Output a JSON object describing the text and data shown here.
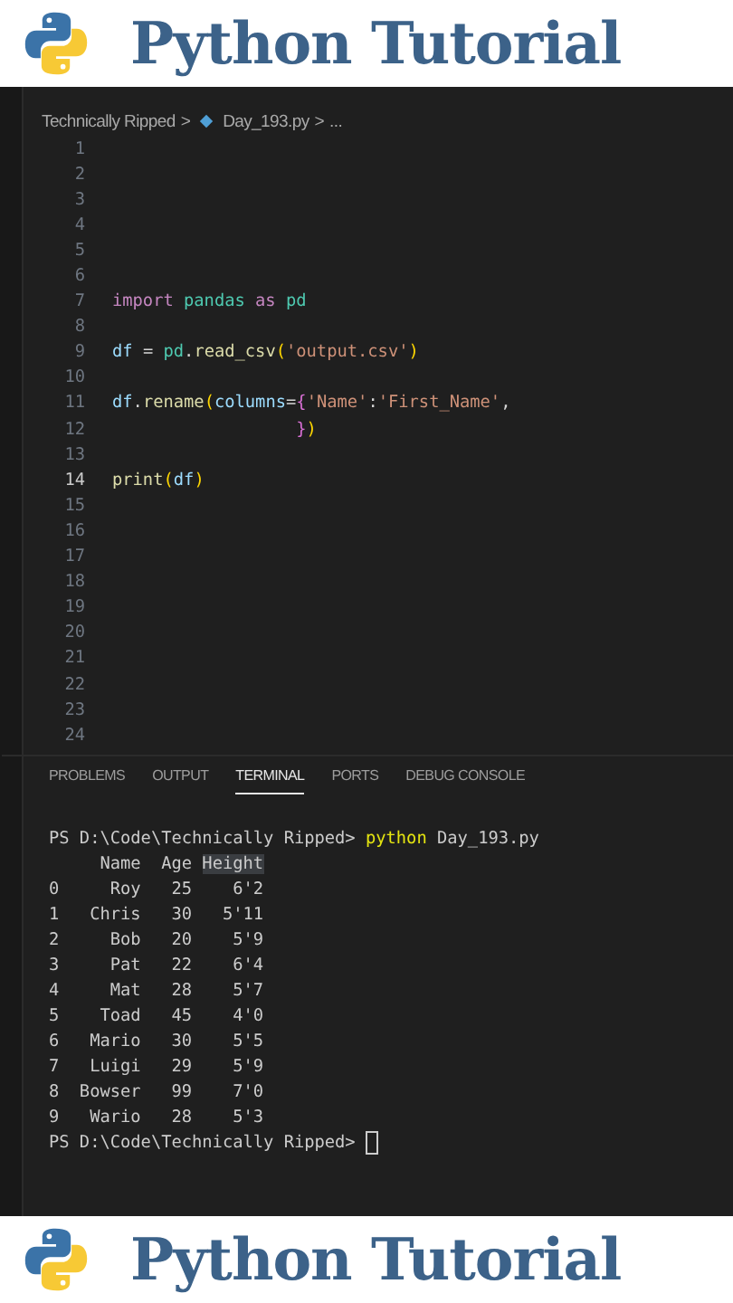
{
  "header": {
    "title": "Python Tutorial"
  },
  "breadcrumb": {
    "folder": "Technically Ripped",
    "separator": ">",
    "file": "Day_193.py",
    "tail": "..."
  },
  "code_lines": [
    {
      "number": "1",
      "current": false
    },
    {
      "number": "2",
      "current": false
    },
    {
      "number": "3",
      "current": false
    },
    {
      "number": "4",
      "current": false
    },
    {
      "number": "5",
      "current": false
    },
    {
      "number": "6",
      "current": false
    },
    {
      "number": "7",
      "current": false,
      "tokens": [
        {
          "text": "import",
          "kind": "keyword"
        },
        {
          "text": " pandas",
          "kind": "module"
        },
        {
          "text": " as",
          "kind": "keyword"
        },
        {
          "text": " pd",
          "kind": "module"
        }
      ]
    },
    {
      "number": "8",
      "current": false
    },
    {
      "number": "9",
      "current": false,
      "tokens": [
        {
          "text": "df",
          "kind": "variable"
        },
        {
          "text": " = ",
          "kind": "plain"
        },
        {
          "text": "pd",
          "kind": "module"
        },
        {
          "text": ".",
          "kind": "plain"
        },
        {
          "text": "read_csv",
          "kind": "function"
        },
        {
          "text": "(",
          "kind": "bracket"
        },
        {
          "text": "'output.csv'",
          "kind": "string"
        },
        {
          "text": ")",
          "kind": "bracket"
        }
      ]
    },
    {
      "number": "10",
      "current": false
    },
    {
      "number": "11",
      "current": false,
      "tokens": [
        {
          "text": "df",
          "kind": "variable"
        },
        {
          "text": ".",
          "kind": "plain"
        },
        {
          "text": "rename",
          "kind": "function"
        },
        {
          "text": "(",
          "kind": "bracket"
        },
        {
          "text": "columns",
          "kind": "variable"
        },
        {
          "text": "=",
          "kind": "plain"
        },
        {
          "text": "{",
          "kind": "bracket2"
        },
        {
          "text": "'Name'",
          "kind": "string"
        },
        {
          "text": ":",
          "kind": "plain"
        },
        {
          "text": "'First_Name'",
          "kind": "string"
        },
        {
          "text": ",",
          "kind": "plain"
        }
      ]
    },
    {
      "number": "12",
      "current": false,
      "tokens": [
        {
          "text": "                  }",
          "kind": "bracket2"
        },
        {
          "text": ")",
          "kind": "bracket"
        }
      ]
    },
    {
      "number": "13",
      "current": false
    },
    {
      "number": "14",
      "current": true,
      "tokens": [
        {
          "text": "print",
          "kind": "function"
        },
        {
          "text": "(",
          "kind": "bracket"
        },
        {
          "text": "df",
          "kind": "variable"
        },
        {
          "text": ")",
          "kind": "bracket"
        }
      ]
    },
    {
      "number": "15",
      "current": false
    },
    {
      "number": "16",
      "current": false
    },
    {
      "number": "17",
      "current": false
    },
    {
      "number": "18",
      "current": false
    },
    {
      "number": "19",
      "current": false
    },
    {
      "number": "20",
      "current": false
    },
    {
      "number": "21",
      "current": false
    },
    {
      "number": "22",
      "current": false
    },
    {
      "number": "23",
      "current": false
    },
    {
      "number": "24",
      "current": false
    }
  ],
  "panel_tabs": [
    {
      "label": "PROBLEMS",
      "selected": false
    },
    {
      "label": "OUTPUT",
      "selected": false
    },
    {
      "label": "TERMINAL",
      "selected": true
    },
    {
      "label": "PORTS",
      "selected": false
    },
    {
      "label": "DEBUG CONSOLE",
      "selected": false
    }
  ],
  "terminal_lines": [
    {
      "tokens": [
        {
          "text": "PS D:\\Code\\Technically Ripped> ",
          "kind": "plain"
        },
        {
          "text": "python",
          "kind": "command"
        },
        {
          "text": " Day_193.py",
          "kind": "plain"
        }
      ]
    },
    {
      "tokens": [
        {
          "text": "     Name  Age ",
          "kind": "plain"
        },
        {
          "text": "Height",
          "kind": "highlight"
        }
      ]
    },
    {
      "tokens": [
        {
          "text": "0     Roy   25    6'2",
          "kind": "plain"
        }
      ]
    },
    {
      "tokens": [
        {
          "text": "1   Chris   30   5'11",
          "kind": "plain"
        }
      ]
    },
    {
      "tokens": [
        {
          "text": "2     Bob   20    5'9",
          "kind": "plain"
        }
      ]
    },
    {
      "tokens": [
        {
          "text": "3     Pat   22    6'4",
          "kind": "plain"
        }
      ]
    },
    {
      "tokens": [
        {
          "text": "4     Mat   28    5'7",
          "kind": "plain"
        }
      ]
    },
    {
      "tokens": [
        {
          "text": "5    Toad   45    4'0",
          "kind": "plain"
        }
      ]
    },
    {
      "tokens": [
        {
          "text": "6   Mario   30    5'5",
          "kind": "plain"
        }
      ]
    },
    {
      "tokens": [
        {
          "text": "7   Luigi   29    5'9",
          "kind": "plain"
        }
      ]
    },
    {
      "tokens": [
        {
          "text": "8  Bowser   99    7'0",
          "kind": "plain"
        }
      ]
    },
    {
      "tokens": [
        {
          "text": "9   Wario   28    5'3",
          "kind": "plain"
        }
      ]
    },
    {
      "tokens": [
        {
          "text": "PS D:\\Code\\Technically Ripped> ",
          "kind": "plain"
        }
      ],
      "cursor": true
    }
  ],
  "footer": {
    "title": "Python Tutorial"
  }
}
